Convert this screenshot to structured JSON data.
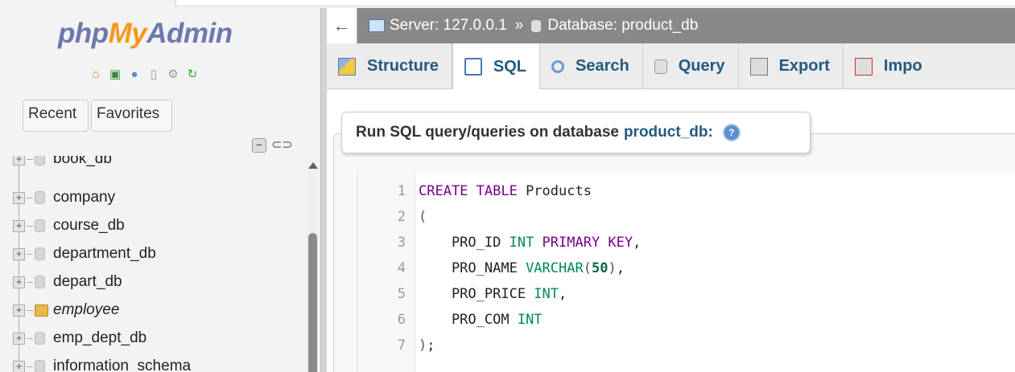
{
  "app": {
    "logo": {
      "part1": "php",
      "part2": "My",
      "part3": "Admin"
    },
    "nav_tabs": {
      "recent": "Recent",
      "favorites": "Favorites"
    }
  },
  "tree": {
    "items": [
      {
        "label": "book_db",
        "italic": false,
        "special": false
      },
      {
        "label": "company",
        "italic": false,
        "special": false
      },
      {
        "label": "course_db",
        "italic": false,
        "special": false
      },
      {
        "label": "department_db",
        "italic": false,
        "special": false
      },
      {
        "label": "depart_db",
        "italic": false,
        "special": false
      },
      {
        "label": "employee",
        "italic": true,
        "special": true
      },
      {
        "label": "emp_dept_db",
        "italic": false,
        "special": false
      },
      {
        "label": "information_schema",
        "italic": false,
        "special": false
      }
    ]
  },
  "breadcrumb": {
    "server": "Server: 127.0.0.1",
    "separator": "»",
    "database": "Database: product_db"
  },
  "tabs": [
    {
      "label": "Structure",
      "icon": "structure-icon",
      "active": false
    },
    {
      "label": "SQL",
      "icon": "sql-icon",
      "active": true
    },
    {
      "label": "Search",
      "icon": "search-icon",
      "active": false
    },
    {
      "label": "Query",
      "icon": "query-icon",
      "active": false
    },
    {
      "label": "Export",
      "icon": "export-icon",
      "active": false
    },
    {
      "label": "Impo",
      "icon": "import-icon",
      "active": false
    }
  ],
  "sql_panel": {
    "legend_prefix": "Run SQL query/queries on database",
    "database_name": "product_db:",
    "help_icon": "help-icon"
  },
  "editor": {
    "lines": [
      {
        "num": "1",
        "tokens": [
          {
            "t": "CREATE TABLE",
            "c": "kw"
          },
          {
            "t": " Products",
            "c": ""
          }
        ]
      },
      {
        "num": "2",
        "tokens": [
          {
            "t": "(",
            "c": "pn"
          }
        ]
      },
      {
        "num": "3",
        "tokens": [
          {
            "t": "    PRO_ID ",
            "c": ""
          },
          {
            "t": "INT",
            "c": "ty"
          },
          {
            "t": " PRIMARY KEY",
            "c": "kw"
          },
          {
            "t": ",",
            "c": ""
          }
        ]
      },
      {
        "num": "4",
        "tokens": [
          {
            "t": "    PRO_NAME ",
            "c": ""
          },
          {
            "t": "VARCHAR",
            "c": "ty"
          },
          {
            "t": "(",
            "c": "pn"
          },
          {
            "t": "50",
            "c": "num"
          },
          {
            "t": ")",
            "c": "pn"
          },
          {
            "t": ",",
            "c": ""
          }
        ]
      },
      {
        "num": "5",
        "tokens": [
          {
            "t": "    PRO_PRICE ",
            "c": ""
          },
          {
            "t": "INT",
            "c": "ty"
          },
          {
            "t": ",",
            "c": ""
          }
        ]
      },
      {
        "num": "6",
        "tokens": [
          {
            "t": "    PRO_COM ",
            "c": ""
          },
          {
            "t": "INT",
            "c": "ty"
          }
        ]
      },
      {
        "num": "7",
        "tokens": [
          {
            "t": ")",
            "c": "pn"
          },
          {
            "t": ";",
            "c": ""
          }
        ]
      }
    ]
  },
  "colors": {
    "accent_blue": "#235a81",
    "logo_orange": "#f29a1f",
    "logo_blue": "#6c78af",
    "breadcrumb_bg": "#888888",
    "keyword": "#770088",
    "type": "#008855"
  }
}
